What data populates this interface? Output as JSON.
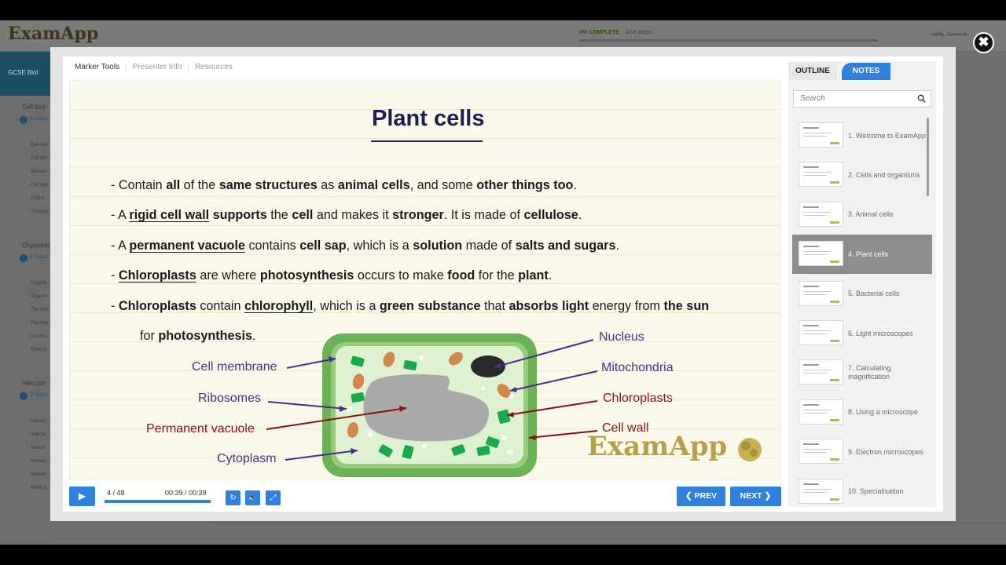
{
  "background_app": {
    "logo": "ExamApp",
    "progress_percent": "0% COMPLETE",
    "progress_steps": "0/54 Steps",
    "hello": "Hello, Ameera!",
    "sidebar_title": "GCSE Biol",
    "sections": [
      {
        "title": "Cell Biol",
        "topics": "6 Topics",
        "items": [
          "Cell biol",
          "Cell biol",
          "Microsc",
          "Cell spe",
          "Culturi",
          "Transpo"
        ]
      },
      {
        "title": "Organisat",
        "topics": "6 Topics",
        "items": [
          "Organis",
          "Organis",
          "The hun",
          "The hea",
          "Corona",
          "Plant tis"
        ]
      },
      {
        "title": "Infection",
        "topics": "6 Topics",
        "items": [
          "Infectio",
          "Infectio",
          "Infectio",
          "Human",
          "Monocl",
          "Plant di"
        ]
      }
    ]
  },
  "modal": {
    "tabs": [
      "Marker Tools",
      "Presenter Info",
      "Resources"
    ],
    "slide": {
      "title": "Plant cells",
      "bullets": [
        {
          "parts": [
            {
              "t": "- Contain "
            },
            {
              "t": "all",
              "b": true
            },
            {
              "t": " of the "
            },
            {
              "t": "same structures",
              "b": true
            },
            {
              "t": " as "
            },
            {
              "t": "animal cells",
              "b": true
            },
            {
              "t": ", and some "
            },
            {
              "t": "other things too",
              "b": true
            },
            {
              "t": "."
            }
          ]
        },
        {
          "parts": [
            {
              "t": "- A "
            },
            {
              "t": "rigid cell wall",
              "b": true,
              "u": true
            },
            {
              "t": " "
            },
            {
              "t": "supports",
              "b": true
            },
            {
              "t": " the "
            },
            {
              "t": "cell",
              "b": true
            },
            {
              "t": " and makes it "
            },
            {
              "t": "stronger",
              "b": true
            },
            {
              "t": ". It is made of "
            },
            {
              "t": "cellulose",
              "b": true
            },
            {
              "t": "."
            }
          ]
        },
        {
          "parts": [
            {
              "t": "- A "
            },
            {
              "t": "permanent vacuole",
              "b": true,
              "u": true
            },
            {
              "t": " contains "
            },
            {
              "t": "cell sap",
              "b": true
            },
            {
              "t": ", which is a "
            },
            {
              "t": "solution",
              "b": true
            },
            {
              "t": " made of "
            },
            {
              "t": "salts and sugars",
              "b": true
            },
            {
              "t": "."
            }
          ]
        },
        {
          "parts": [
            {
              "t": "- "
            },
            {
              "t": "Chloroplasts",
              "b": true,
              "u": true
            },
            {
              "t": " are where "
            },
            {
              "t": "photosynthesis",
              "b": true
            },
            {
              "t": " occurs to make "
            },
            {
              "t": "food",
              "b": true
            },
            {
              "t": " for the "
            },
            {
              "t": "plant",
              "b": true
            },
            {
              "t": "."
            }
          ]
        },
        {
          "parts": [
            {
              "t": "- "
            },
            {
              "t": "Chloroplasts",
              "b": true
            },
            {
              "t": " contain "
            },
            {
              "t": "chlorophyll",
              "b": true,
              "u": true
            },
            {
              "t": ", which is a "
            },
            {
              "t": "green substance",
              "b": true
            },
            {
              "t": " that "
            },
            {
              "t": "absorbs light",
              "b": true
            },
            {
              "t": " energy from "
            },
            {
              "t": "the sun",
              "b": true
            }
          ]
        },
        {
          "parts": [
            {
              "t": "for "
            },
            {
              "t": "photosynthesis",
              "b": true
            },
            {
              "t": "."
            }
          ]
        }
      ],
      "labels_left": [
        "Cell membrane",
        "Ribosomes",
        "Permanent vacuole",
        "Cytoplasm"
      ],
      "labels_right": [
        "Nucleus",
        "Mitochondria",
        "Chloroplasts",
        "Cell wall"
      ],
      "watermark": "ExamApp"
    },
    "player": {
      "slide_count": "4 / 48",
      "time": "00:39 / 00:39",
      "progress": 1.0,
      "prev_label": "PREV",
      "next_label": "NEXT"
    },
    "sidebar": {
      "tab_outline": "OUTLINE",
      "tab_notes": "NOTES",
      "search_placeholder": "Search",
      "items": [
        "1. Welcome to ExamApp",
        "2. Cells and organisms",
        "3. Animal cells",
        "4. Plant cells",
        "5. Bacterial cells",
        "6. Light microscopes",
        "7. Calculating magnification",
        "8. Using a microscope",
        "9. Electron microscopes",
        "10. Specialisation"
      ],
      "active_index": 3
    }
  },
  "colors": {
    "accent": "#2f7fdc",
    "title": "#1c1e54",
    "label_purple": "#4b2d8c",
    "label_red": "#8b0f14",
    "cell_green": "#5aae4a"
  }
}
